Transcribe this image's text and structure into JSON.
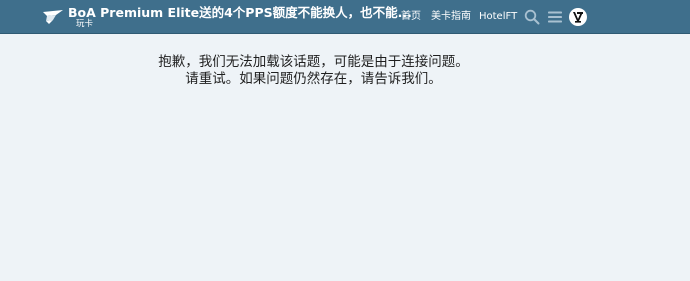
{
  "header": {
    "topic_title": "BoA Premium Elite送的4个PPS额度不能换人，也不能...",
    "category": "玩卡",
    "nav": {
      "home": "首页",
      "us_card_guide": "美卡指南",
      "hotelft": "HotelFT"
    },
    "icons": {
      "logo": "paper-plane-icon",
      "search": "search-icon",
      "menu": "hamburger-icon",
      "avatar": "user-avatar"
    },
    "colors": {
      "bar": "#3f6f8c",
      "text": "#ffffff"
    }
  },
  "main": {
    "error_line1": "抱歉，我们无法加载该话题，可能是由于连接问题。",
    "error_line2": "请重试。如果问题仍然存在，请告诉我们。",
    "background": "#eef3f7"
  }
}
